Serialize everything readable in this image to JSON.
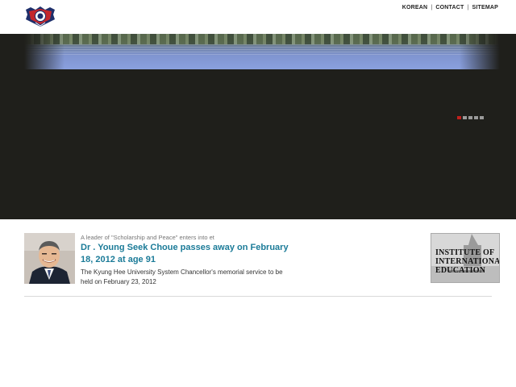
{
  "header": {
    "logo_icon": "university-crest-icon",
    "nav": [
      {
        "label": "KOREAN"
      },
      {
        "label": "CONTACT"
      },
      {
        "label": "SITEMAP"
      }
    ],
    "separator": "|"
  },
  "hero": {
    "slide_count": 5,
    "active_slide": 1,
    "active_color": "#c0201c",
    "inactive_color": "#9a9a9a",
    "background": "#1f1f1b"
  },
  "news": {
    "kicker": "A leader of \"Scholarship and Peace\" enters into et",
    "headline": "Dr . Young Seek Choue passes away on February 18, 2012 at age 91",
    "summary": "The Kyung Hee University System Chancellor's memorial service to be held on February 23, 2012",
    "headline_color": "#1b7b98"
  },
  "side_banner": {
    "line1": "INSTITUTE OF",
    "line2": "INTERNATIONAL",
    "line3": "EDUCATION"
  }
}
